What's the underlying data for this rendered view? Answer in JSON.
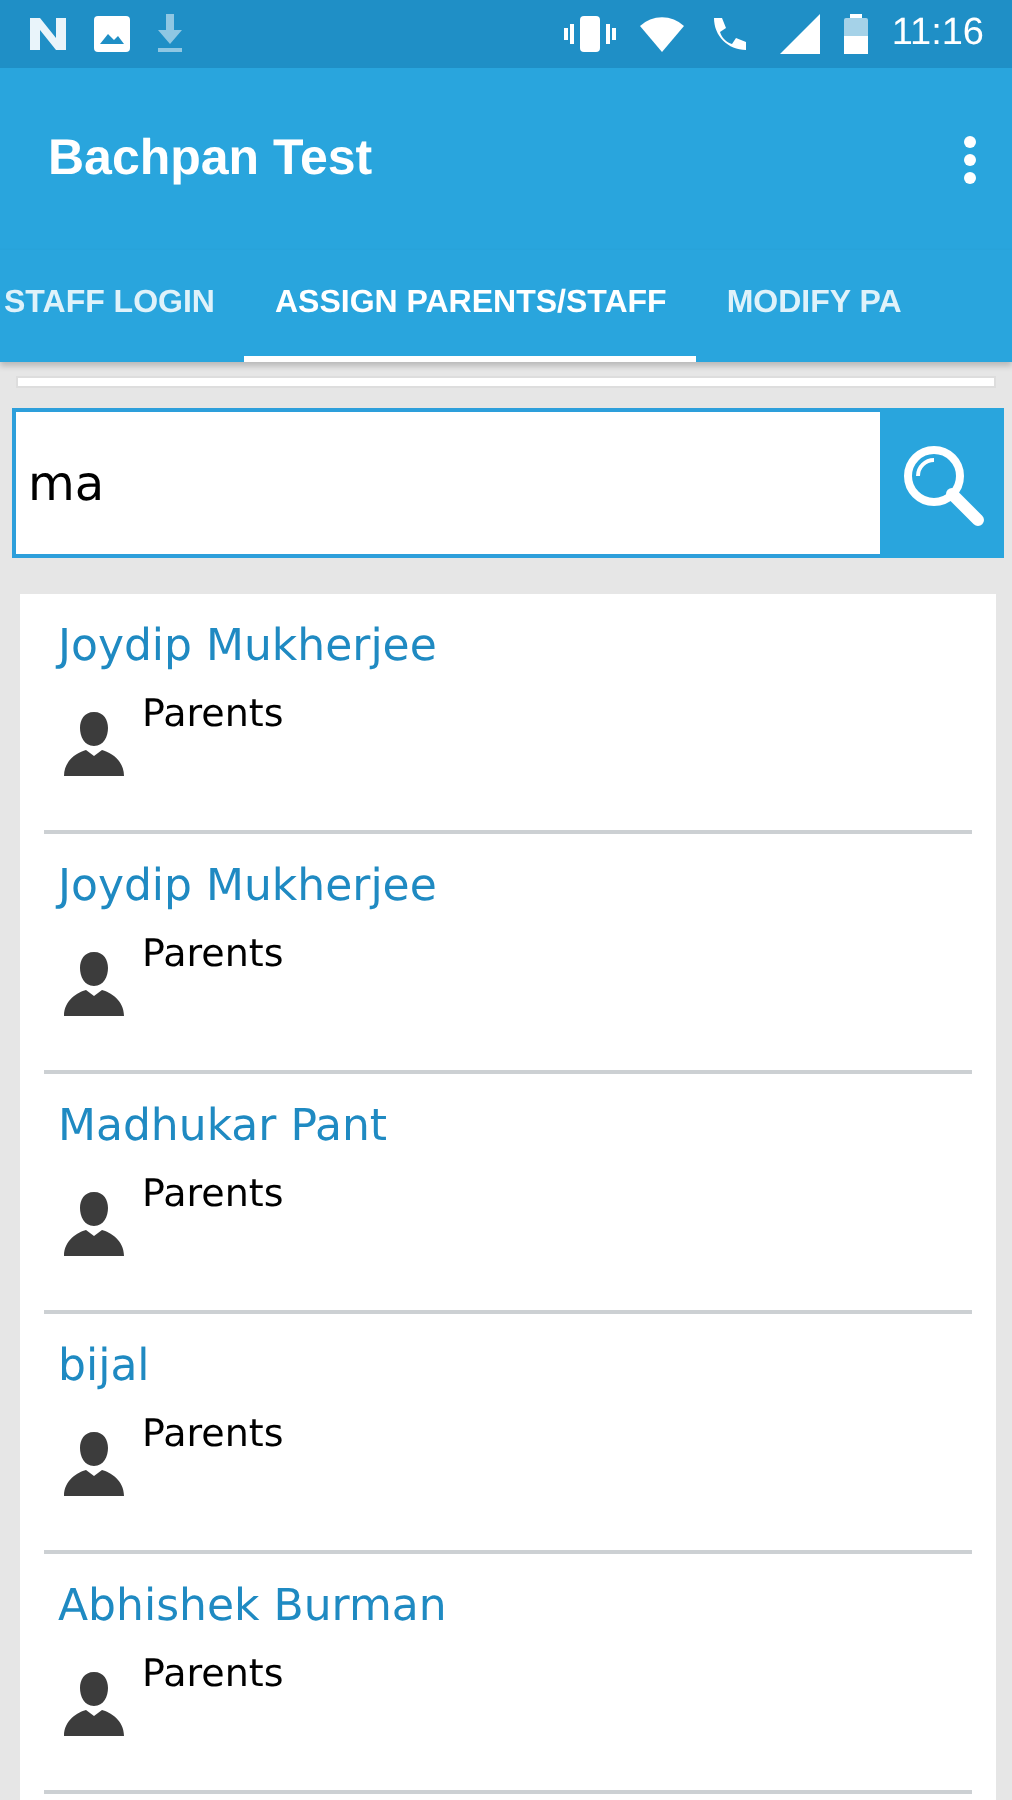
{
  "status_bar": {
    "time": "11:16"
  },
  "app_bar": {
    "title": "Bachpan Test"
  },
  "tabs": [
    {
      "label": "STAFF LOGIN",
      "selected": false
    },
    {
      "label": "ASSIGN PARENTS/STAFF",
      "selected": true
    },
    {
      "label": "MODIFY PA",
      "selected": false
    }
  ],
  "search": {
    "value": "ma"
  },
  "results": [
    {
      "name": "Joydip Mukherjee",
      "role": "Parents"
    },
    {
      "name": "Joydip Mukherjee",
      "role": "Parents"
    },
    {
      "name": "Madhukar Pant",
      "role": "Parents"
    },
    {
      "name": "bijal",
      "role": "Parents"
    },
    {
      "name": "Abhishek Burman",
      "role": "Parents"
    }
  ]
}
